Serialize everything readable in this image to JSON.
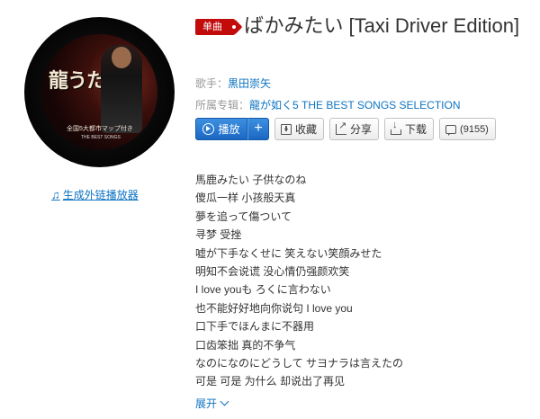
{
  "album_art": {
    "cover_title": "龍うた",
    "cover_subtitle": "全国5大都市マップ付き",
    "cover_subtitle2": "THE BEST SONGS"
  },
  "external_link": {
    "icon": "music-note-icon",
    "label": "生成外链播放器"
  },
  "badge": {
    "label": "单曲"
  },
  "song": {
    "title": "ばかみたい [Taxi Driver Edition]"
  },
  "singer": {
    "label": "歌手：",
    "name": "黒田崇矢"
  },
  "album": {
    "label": "所属专辑：",
    "name": "龍が如く5 THE BEST SONGS SELECTION"
  },
  "buttons": {
    "play": "播放",
    "add": "+",
    "collect": "收藏",
    "share": "分享",
    "download": "下载",
    "comment_count": "(9155)"
  },
  "lyrics": [
    "馬鹿みたい 子供なのね",
    "傻瓜一样 小孩般天真",
    "夢を追って傷ついて",
    "寻梦 受挫",
    "嘘が下手なくせに 笑えない笑顔みせた",
    "明知不会说谎 没心情仍强颜欢笑",
    "I love youも ろくに言わない",
    "也不能好好地向你说句 I love you",
    "口下手でほんまに不器用",
    "口齿笨拙 真的不争气",
    "なのになのにどうして サヨナラは言えたの",
    "可是 可是 为什么 却说出了再见"
  ],
  "expand_label": "展开"
}
